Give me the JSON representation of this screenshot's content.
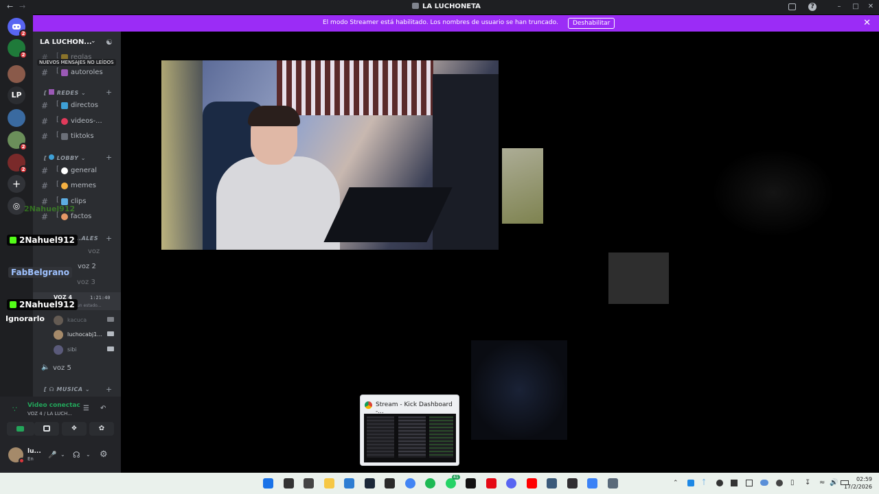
{
  "window": {
    "title": "LA LUCHONETA",
    "back_icon": "←",
    "forward_icon": "→"
  },
  "streamer_banner": {
    "message": "El modo Streamer está habilitado. Los nombres de usuario se han truncado.",
    "button": "Deshabilitar",
    "close_icon": "✕"
  },
  "guilds": {
    "items": [
      {
        "color": "#5865f2",
        "badge": "2"
      },
      {
        "color": "#1f7a3a",
        "badge": "2"
      },
      {
        "color": "#8a5a4a",
        "badge": ""
      },
      {
        "label": "LP",
        "color": "#2b2d31",
        "badge": ""
      },
      {
        "color": "#3a6aa0",
        "badge": ""
      },
      {
        "color": "#6b8f5a",
        "badge": "2"
      },
      {
        "color": "#7a2a2a",
        "badge": "2"
      }
    ],
    "add_icon": "+",
    "discover_icon": "◎"
  },
  "sidebar": {
    "server_name": "LA LUCHON...",
    "chevron": "⌄",
    "unread_pill": "NUEVOS MENSAJES NO LEÍDOS",
    "channels_top": [
      {
        "name": "reglas",
        "color": "#c9a227"
      },
      {
        "name": "autoroles",
        "color": "#9b59b6"
      }
    ],
    "cat_redes": "REDES",
    "redes": [
      {
        "name": "directos",
        "color": "#3ea0d6"
      },
      {
        "name": "videos-...",
        "color": "#e03a5a"
      },
      {
        "name": "tiktoks",
        "color": "#6b6f78"
      }
    ],
    "cat_lobby": "LOBBY",
    "lobby": [
      {
        "name": "general",
        "color": "#ffffff"
      },
      {
        "name": "memes",
        "color": "#f5b041"
      },
      {
        "name": "clips",
        "color": "#5dade2"
      },
      {
        "name": "factos",
        "color": "#e59866"
      }
    ],
    "cat_canales": "...ALES",
    "voice": [
      {
        "name": "voz",
        "top": 0
      },
      {
        "name": "voz 2",
        "top": 0
      },
      {
        "name": "voz 3",
        "top": 0
      }
    ],
    "voz4": "VOZ 4",
    "voz4_time": "1:21:40",
    "voz4_status": "un estado...",
    "voice_users": [
      {
        "name": "kacuca",
        "color": "#8a7a6a"
      },
      {
        "name": "luchocabj1...",
        "color": "#a58a6a"
      },
      {
        "name": "sibi",
        "color": "#5a5a7a"
      }
    ],
    "voz5": "voz 5",
    "cat_musica": "MUSICA"
  },
  "overlay": {
    "user1": "2Nahuel912",
    "user1_ghost": "2Nahuel912",
    "user2": "FabBelgrano",
    "user3": "2Nahuel912",
    "ignore": "Ignorarlo"
  },
  "user_panel": {
    "voice_status": "Video conectac",
    "voice_channel": "VOZ 4 / LA LUCH...",
    "username": "lu...",
    "userstatus": "En"
  },
  "thumbnail": {
    "label": "Stream - Kick Dashboard -..."
  },
  "taskbar": {
    "time": "02:59",
    "date": "17/2/2026",
    "apps": [
      {
        "name": "windows-start",
        "color": "#1a73e8"
      },
      {
        "name": "search",
        "color": "#333333"
      },
      {
        "name": "task-view",
        "color": "#444444"
      },
      {
        "name": "file-explorer",
        "color": "#f6c744"
      },
      {
        "name": "store",
        "color": "#2d7dd2"
      },
      {
        "name": "steam",
        "color": "#1b2838"
      },
      {
        "name": "epic-games",
        "color": "#2a2a2a"
      },
      {
        "name": "chrome",
        "color": "#4285f4"
      },
      {
        "name": "spotify",
        "color": "#1db954"
      },
      {
        "name": "whatsapp",
        "color": "#25d366"
      },
      {
        "name": "chatgpt",
        "color": "#111111"
      },
      {
        "name": "netflix",
        "color": "#e50914"
      },
      {
        "name": "discord",
        "color": "#5865f2"
      },
      {
        "name": "youtube",
        "color": "#ff0000"
      },
      {
        "name": "photos",
        "color": "#3a5a7a"
      },
      {
        "name": "obs",
        "color": "#302e31"
      },
      {
        "name": "notepad",
        "color": "#3b82f6"
      },
      {
        "name": "settings",
        "color": "#5a6a7a"
      }
    ],
    "badges": {
      "whatsapp": "41"
    }
  }
}
